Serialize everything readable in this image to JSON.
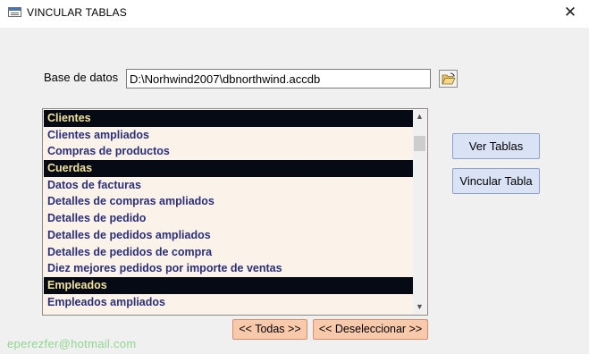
{
  "window": {
    "title": "VINCULAR TABLAS",
    "close_glyph": "✕"
  },
  "database": {
    "label": "Base de datos",
    "path": "D:\\Norhwind2007\\dbnorthwind.accdb",
    "browse_icon": "folder-open-icon"
  },
  "tables": {
    "items": [
      {
        "label": "Clientes",
        "selected": true
      },
      {
        "label": "Clientes ampliados",
        "selected": false
      },
      {
        "label": "Compras de productos",
        "selected": false
      },
      {
        "label": "Cuerdas",
        "selected": true
      },
      {
        "label": "Datos de facturas",
        "selected": false
      },
      {
        "label": "Detalles de compras ampliados",
        "selected": false
      },
      {
        "label": "Detalles de pedido",
        "selected": false
      },
      {
        "label": "Detalles de pedidos ampliados",
        "selected": false
      },
      {
        "label": "Detalles de pedidos de compra",
        "selected": false
      },
      {
        "label": "Diez mejores pedidos por importe de ventas",
        "selected": false
      },
      {
        "label": "Empleados",
        "selected": true
      },
      {
        "label": "Empleados ampliados",
        "selected": false
      }
    ]
  },
  "buttons": {
    "ver_tablas": "Ver Tablas",
    "vincular_tabla": "Vincular Tabla",
    "todas": "<< Todas >>",
    "deseleccionar": "<< Deseleccionar >>"
  },
  "footer": {
    "email": "eperezfer@hotmail.com"
  },
  "colors": {
    "selected_bg": "#050a14",
    "selected_text": "#f2e39a",
    "item_text": "#2b2e7a",
    "list_bg": "#fbf3ea",
    "blue_button": "#d9e3f5",
    "peach_button": "#f8c9aa",
    "email": "#8fd68f"
  }
}
